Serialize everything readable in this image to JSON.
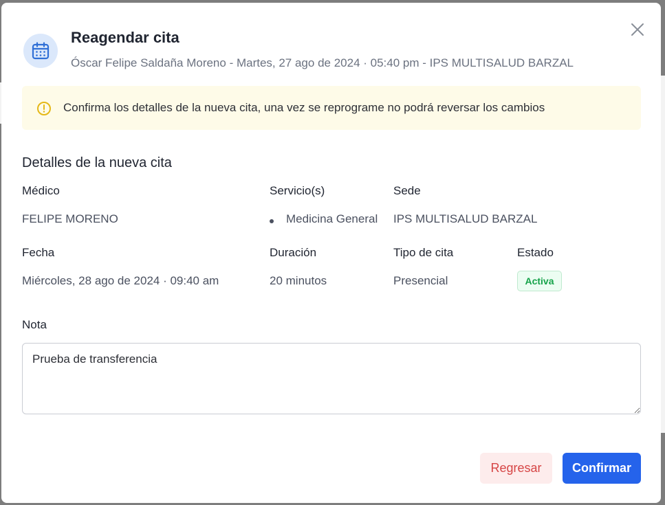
{
  "dialog": {
    "title": "Reagendar cita",
    "subtitle": "Óscar Felipe Saldaña Moreno - Martes, 27 ago de 2024 · 05:40 pm - IPS MULTISALUD BARZAL",
    "header_icon": "calendar-icon",
    "close_icon": "close-icon"
  },
  "alert": {
    "icon": "warning-icon",
    "text": "Confirma los detalles de la nueva cita, una vez se reprograme no podrá reversar los cambios",
    "color": "#fefbe8"
  },
  "details": {
    "section_title": "Detalles de la nueva cita",
    "medico_label": "Médico",
    "medico_value": "FELIPE MORENO",
    "servicios_label": "Servicio(s)",
    "servicios_items": [
      "Medicina General"
    ],
    "sede_label": "Sede",
    "sede_value": "IPS MULTISALUD BARZAL",
    "fecha_label": "Fecha",
    "fecha_value": "Miércoles, 28 ago de 2024 · 09:40 am",
    "duracion_label": "Duración",
    "duracion_value": "20 minutos",
    "tipo_label": "Tipo de cita",
    "tipo_value": "Presencial",
    "estado_label": "Estado",
    "estado_value": "Activa",
    "estado_color": "#16a34a"
  },
  "note": {
    "label": "Nota",
    "value": "Prueba de transferencia"
  },
  "actions": {
    "back_label": "Regresar",
    "confirm_label": "Confirmar",
    "confirm_color": "#2563eb",
    "back_color": "#d64545"
  }
}
